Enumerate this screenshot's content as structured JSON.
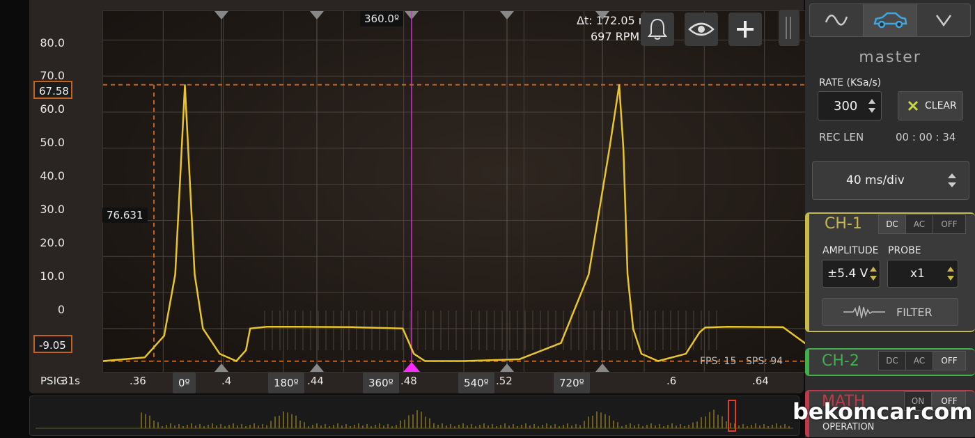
{
  "scope": {
    "y_ticks": [
      "80.0",
      "70.0",
      "60.0",
      "50.0",
      "40.0",
      "30.0",
      "20.0",
      "10.0",
      "0"
    ],
    "unit_label": "PSIG",
    "x_ticks": [
      "31s",
      ".36",
      ".4",
      ".44",
      ".48",
      ".52",
      ".6",
      ".64"
    ],
    "angle_markers": [
      "0º",
      "180º",
      "360º",
      "540º",
      "720º"
    ],
    "top_cursor_label": "360.0º",
    "delta_t": "Δt: 172.05 ms",
    "rpm": "697 RPM",
    "upper_level": "67.58",
    "lower_level": "-9.05",
    "cursor_value": "76.631",
    "fps": "FPS: 15",
    "sps": "SPS: 94",
    "colors": {
      "trace": "#e8c52a",
      "cursor": "#cc33cc",
      "level": "#c4631d"
    }
  },
  "chart_data": {
    "type": "line",
    "ylabel": "PSIG",
    "ylim": [
      -12,
      88
    ],
    "series": [
      {
        "name": "CH-1",
        "x": [
          0.33,
          0.345,
          0.352,
          0.356,
          0.358,
          0.3595,
          0.361,
          0.363,
          0.366,
          0.372,
          0.378,
          0.3815,
          0.383,
          0.389,
          0.4,
          0.42,
          0.438,
          0.442,
          0.446,
          0.452,
          0.46,
          0.48,
          0.495,
          0.505,
          0.5125,
          0.516,
          0.5175,
          0.519,
          0.521,
          0.524,
          0.53,
          0.54,
          0.545,
          0.547,
          0.555,
          0.575,
          0.59
        ],
        "y": [
          -9,
          -8,
          -2,
          15,
          45,
          67.5,
          45,
          15,
          0,
          -7,
          -9,
          -6,
          0,
          0.5,
          0.5,
          0.4,
          0,
          -7,
          -9,
          -9,
          -9,
          -8.5,
          -4,
          15,
          50,
          67.5,
          50,
          15,
          0,
          -7,
          -9,
          -7,
          -1,
          0.3,
          0.5,
          0.4,
          -8
        ]
      }
    ]
  },
  "sidebar": {
    "mode_icons": [
      "wave-icon",
      "car-icon",
      "chevron-down-icon"
    ],
    "title": "master",
    "rate_label": "RATE (KSa/s)",
    "rate_value": "300",
    "clear_label": "CLEAR",
    "rec_len_label": "REC LEN",
    "rec_len_value": "00 : 00 : 34",
    "timebase": "40 ms/div"
  },
  "ch1": {
    "name": "CH-1",
    "coupling": [
      "DC",
      "AC",
      "OFF"
    ],
    "amplitude_label": "AMPLITUDE",
    "probe_label": "PROBE",
    "amplitude_value": "±5.4 V",
    "probe_value": "x1",
    "filter_label": "FILTER",
    "color": "#c9b84a"
  },
  "ch2": {
    "name": "CH-2",
    "coupling": [
      "DC",
      "AC",
      "OFF"
    ],
    "color": "#3fb04a"
  },
  "math": {
    "name": "MATH",
    "buttons": [
      "ON",
      "OFF"
    ],
    "operation_label": "OPERATION",
    "color": "#c0394a"
  },
  "watermark": "bekomcar.com"
}
